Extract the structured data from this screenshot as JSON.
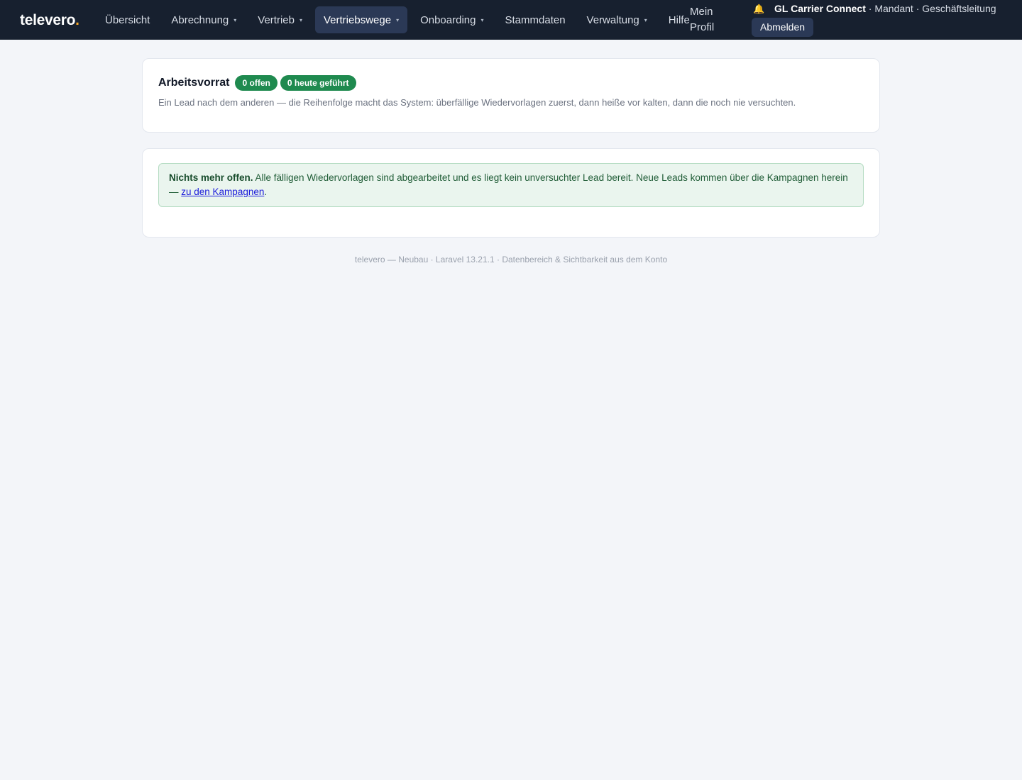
{
  "brand": {
    "name": "televero",
    "dot": "."
  },
  "nav": {
    "items": [
      {
        "label": "Übersicht",
        "caret": ""
      },
      {
        "label": "Abrechnung",
        "caret": "▾"
      },
      {
        "label": "Vertrieb",
        "caret": "▾"
      },
      {
        "label": "Vertriebswege",
        "caret": "▾"
      },
      {
        "label": "Onboarding",
        "caret": "▾"
      },
      {
        "label": "Stammdaten",
        "caret": ""
      },
      {
        "label": "Verwaltung",
        "caret": "▾"
      },
      {
        "label": "Hilfe",
        "caret": ""
      }
    ],
    "profile_line1": "Mein",
    "profile_line2": "Profil"
  },
  "account": {
    "bell_icon": "🔔",
    "company": "GL Carrier Connect",
    "role": " · Mandant · Geschäftsleitung",
    "logout_label": "Abmelden"
  },
  "worklist": {
    "title": "Arbeitsvorrat",
    "badge_open": "0 offen",
    "badge_today": "0 heute geführt",
    "description": "Ein Lead nach dem anderen — die Reihenfolge macht das System: überfällige Wiedervorlagen zuerst, dann heiße vor kalten, dann die noch nie versuchten."
  },
  "notice": {
    "strong": "Nichts mehr offen.",
    "text": " Alle fälligen Wiedervorlagen sind abgearbeitet und es liegt kein unversuchter Lead bereit. Neue Leads kommen über die Kampagnen herein — ",
    "link": "zu den Kampagnen",
    "end": "."
  },
  "footer": {
    "text": "televero — Neubau · Laravel 13.21.1 · Datenbereich & Sichtbarkeit aus dem Konto"
  },
  "colors": {
    "topbar": "#17202f",
    "active_nav": "#2b3956",
    "badge": "#1f8a4f",
    "brand_dot": "#f5a524"
  }
}
